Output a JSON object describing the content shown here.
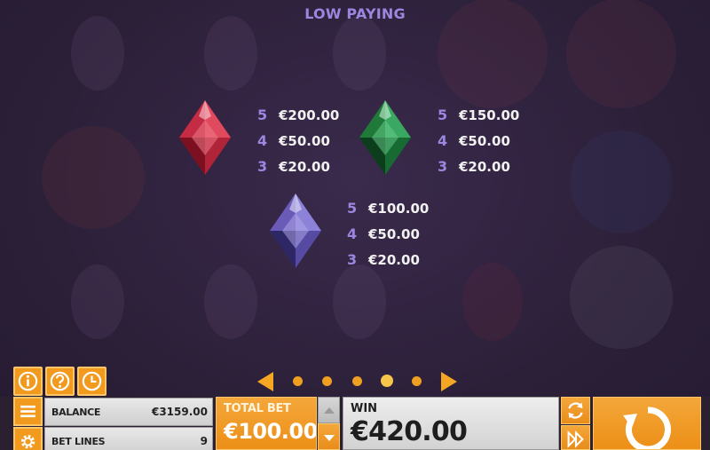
{
  "paytable": {
    "title": "LOW PAYING",
    "symbols": [
      {
        "name": "red-gem",
        "color": "#c0283e",
        "pays": [
          {
            "count": "5",
            "value": "€200.00"
          },
          {
            "count": "4",
            "value": "€50.00"
          },
          {
            "count": "3",
            "value": "€20.00"
          }
        ]
      },
      {
        "name": "green-gem",
        "color": "#1f7a3a",
        "pays": [
          {
            "count": "5",
            "value": "€150.00"
          },
          {
            "count": "4",
            "value": "€50.00"
          },
          {
            "count": "3",
            "value": "€20.00"
          }
        ]
      },
      {
        "name": "purple-gem",
        "color": "#6a5bb8",
        "pays": [
          {
            "count": "5",
            "value": "€100.00"
          },
          {
            "count": "4",
            "value": "€50.00"
          },
          {
            "count": "3",
            "value": "€20.00"
          }
        ]
      }
    ]
  },
  "pager": {
    "pages": 5,
    "active_page": 4
  },
  "toolbar": {
    "icons": [
      "info-icon",
      "help-icon",
      "history-icon",
      "menu-icon",
      "settings-icon",
      "autoplay-icon",
      "fast-forward-icon",
      "spin-icon"
    ]
  },
  "status": {
    "balance_label": "BALANCE",
    "balance_value": "€3159.00",
    "betlines_label": "BET LINES",
    "betlines_value": "9",
    "totalbet_label": "TOTAL BET",
    "totalbet_value": "€100.00",
    "win_label": "WIN",
    "win_value": "€420.00"
  },
  "colors": {
    "accent": "#f29a1e",
    "accent_light": "#fbc569",
    "title": "#9b86e0",
    "background": "#2c2039"
  }
}
